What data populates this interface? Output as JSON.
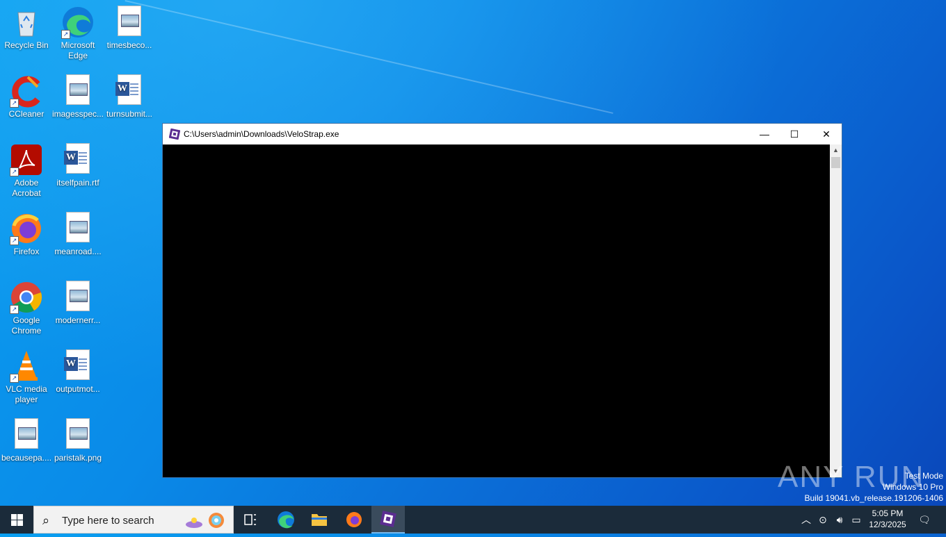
{
  "desktop": {
    "icons": [
      {
        "label": "Recycle Bin",
        "icon": "recycle-bin-icon"
      },
      {
        "label": "Microsoft Edge",
        "icon": "edge-icon"
      },
      {
        "label": "timesbeco...",
        "icon": "image-file-icon"
      },
      {
        "label": "CCleaner",
        "icon": "ccleaner-icon"
      },
      {
        "label": "imagesspec...",
        "icon": "image-file-icon"
      },
      {
        "label": "turnsubmit...",
        "icon": "word-file-icon"
      },
      {
        "label": "Adobe Acrobat",
        "icon": "acrobat-icon"
      },
      {
        "label": "itselfpain.rtf",
        "icon": "word-file-icon"
      },
      {
        "label": "Firefox",
        "icon": "firefox-icon"
      },
      {
        "label": "meanroad....",
        "icon": "image-file-icon"
      },
      {
        "label": "Google Chrome",
        "icon": "chrome-icon"
      },
      {
        "label": "modernerr...",
        "icon": "image-file-icon"
      },
      {
        "label": "VLC media player",
        "icon": "vlc-icon"
      },
      {
        "label": "outputmot...",
        "icon": "word-file-icon"
      },
      {
        "label": "becausepa....",
        "icon": "image-file-icon"
      },
      {
        "label": "paristalk.png",
        "icon": "image-file-icon"
      }
    ]
  },
  "window": {
    "title": "C:\\Users\\admin\\Downloads\\VeloStrap.exe",
    "minimize": "—",
    "maximize": "☐",
    "close": "✕"
  },
  "watermark": {
    "line1": "Test Mode",
    "line2": "Windows 10 Pro",
    "line3": "Build 19041.vb_release.191206-1406",
    "logo": "ANY RUN"
  },
  "taskbar": {
    "search_placeholder": "Type here to search",
    "time": "5:05 PM",
    "date": "12/3/2025"
  },
  "colors": {
    "taskbar": "#1b2b3a",
    "console": "#000000",
    "desktop_accent": "#0a8ae8"
  }
}
